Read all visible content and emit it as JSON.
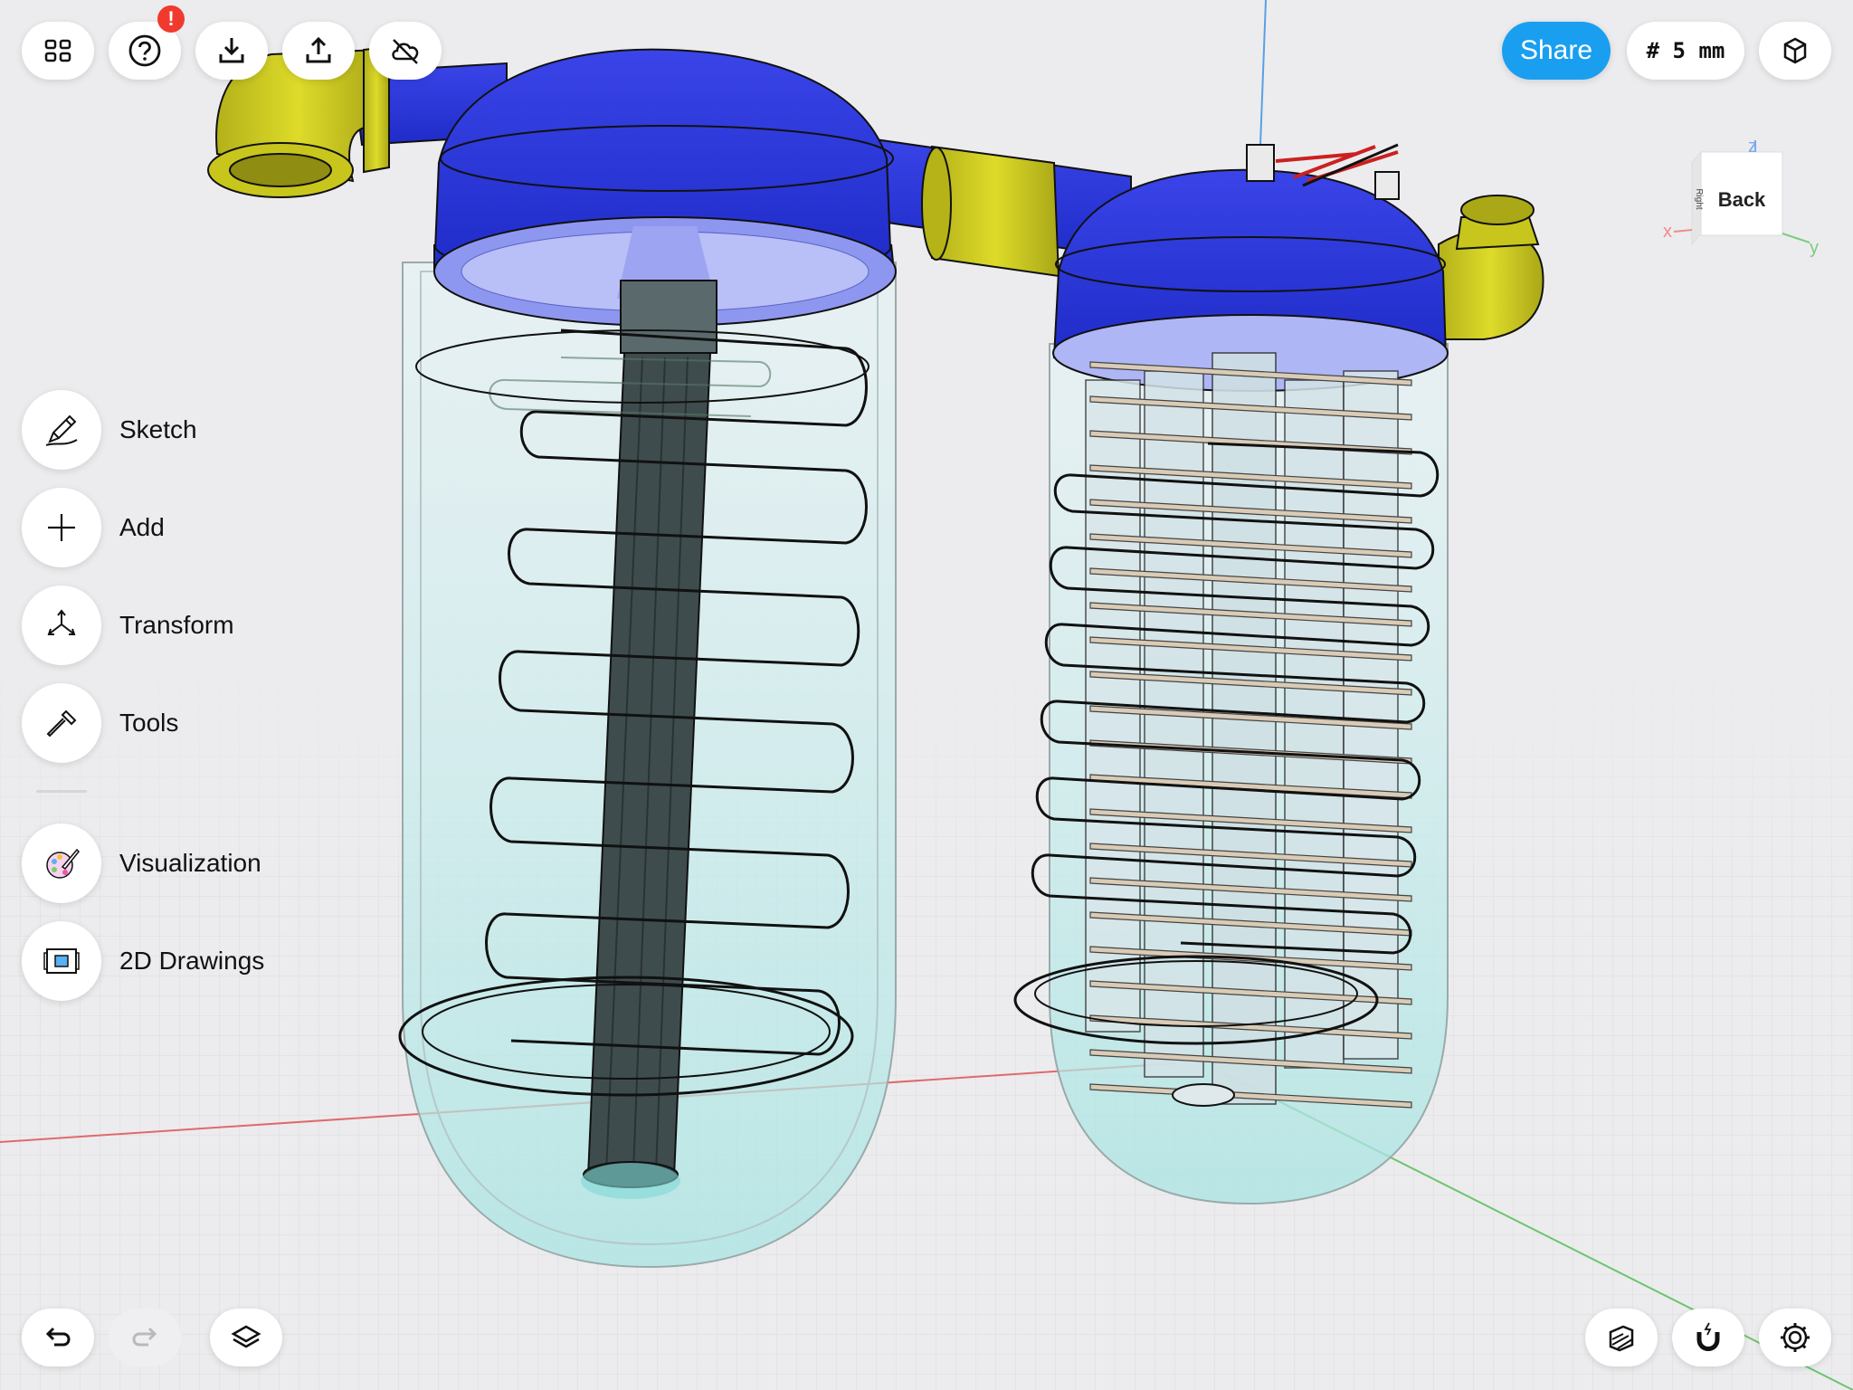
{
  "toolbar": {
    "home_icon": "grid-icon",
    "help_badge": "!",
    "share_label": "Share",
    "grid_size": "# 5 mm"
  },
  "sidebar": {
    "items": [
      {
        "label": "Sketch",
        "icon": "pencil-icon"
      },
      {
        "label": "Add",
        "icon": "plus-icon"
      },
      {
        "label": "Transform",
        "icon": "transform-icon"
      },
      {
        "label": "Tools",
        "icon": "hammer-icon"
      },
      {
        "label": "Visualization",
        "icon": "palette-icon"
      },
      {
        "label": "2D Drawings",
        "icon": "blueprint-icon"
      }
    ]
  },
  "viewcube": {
    "face_front": "Back",
    "face_side": "Right",
    "axis_x": "x",
    "axis_y": "y",
    "axis_z": "z"
  },
  "colors": {
    "accent": "#1a9ff0",
    "badge": "#f03a2e",
    "cap_blue": "#2e3bdc",
    "pipe_yellow": "#c9c71e",
    "glass": "#bfe8e8"
  }
}
